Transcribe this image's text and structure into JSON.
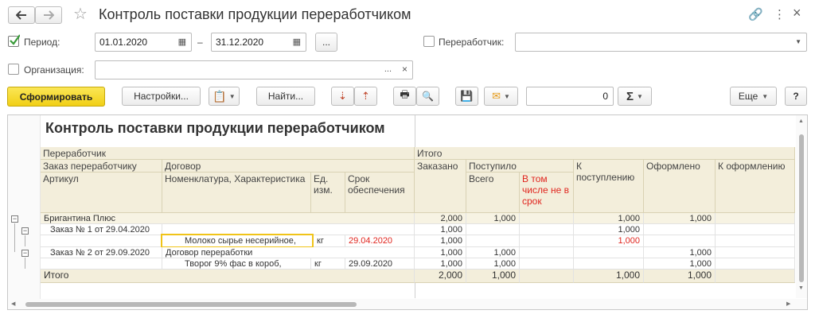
{
  "window": {
    "title": "Контроль поставки продукции переработчиком"
  },
  "filters": {
    "period_label": "Период:",
    "period_checked": true,
    "date_from": "01.01.2020",
    "dash": "–",
    "date_to": "31.12.2020",
    "ellipsis": "...",
    "processor_label": "Переработчик:",
    "processor_value": "",
    "org_label": "Организация:",
    "org_value": "",
    "clear": "×"
  },
  "toolbar": {
    "generate": "Сформировать",
    "settings": "Настройки...",
    "find": "Найти...",
    "sum_value": "0",
    "more": "Еще",
    "help": "?"
  },
  "report": {
    "title": "Контроль поставки продукции переработчиком",
    "headers": {
      "processor": "Переработчик",
      "total_group": "Итого",
      "order": "Заказ переработчику",
      "contract": "Договор",
      "article": "Артикул",
      "nomenclature": "Номенклатура, Характеристика",
      "unit": "Ед. изм.",
      "deadline": "Срок обеспечения",
      "ordered": "Заказано",
      "received": "Поступило",
      "received_total": "Всего",
      "received_late": "В том числе не в срок",
      "to_receive": "К поступлению",
      "registered": "Оформлено",
      "to_register": "К оформлению"
    },
    "rows": [
      {
        "label": "Бригантина Плюс",
        "contract": "",
        "unit": "",
        "date": "",
        "ordered": "2,000",
        "rec_total": "1,000",
        "rec_late": "",
        "to_receive": "1,000",
        "registered": "1,000",
        "to_register": ""
      },
      {
        "label": "Заказ № 1 от 29.04.2020",
        "contract": "",
        "unit": "",
        "date": "",
        "ordered": "1,000",
        "rec_total": "",
        "rec_late": "",
        "to_receive": "1,000",
        "registered": "",
        "to_register": ""
      },
      {
        "label": "",
        "contract": "Молоко сырье несерийное,",
        "unit": "кг",
        "date": "29.04.2020",
        "ordered": "1,000",
        "rec_total": "",
        "rec_late": "",
        "to_receive": "1,000",
        "registered": "",
        "to_register": ""
      },
      {
        "label": "Заказ № 2 от 29.09.2020",
        "contract": "Договор переработки",
        "unit": "",
        "date": "",
        "ordered": "1,000",
        "rec_total": "1,000",
        "rec_late": "",
        "to_receive": "",
        "registered": "1,000",
        "to_register": ""
      },
      {
        "label": "",
        "contract": "Творог 9% фас в короб,",
        "unit": "кг",
        "date": "29.09.2020",
        "ordered": "1,000",
        "rec_total": "1,000",
        "rec_late": "",
        "to_receive": "",
        "registered": "1,000",
        "to_register": ""
      }
    ],
    "total": {
      "label": "Итого",
      "ordered": "2,000",
      "rec_total": "1,000",
      "to_receive": "1,000",
      "registered": "1,000"
    }
  },
  "colors": {
    "accent_yellow": "#f1cf16",
    "header_bg": "#f3eedb",
    "overdue_red": "#e0261f",
    "selection": "#f0c419"
  }
}
